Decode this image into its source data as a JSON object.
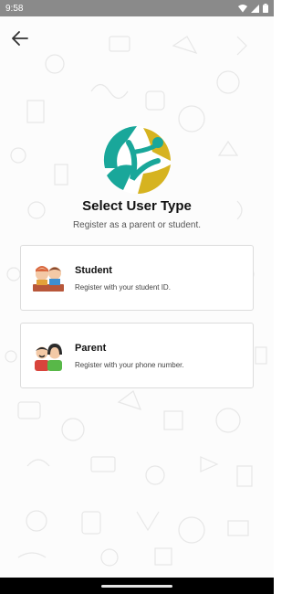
{
  "status_bar": {
    "time": "9:58"
  },
  "header": {
    "back_icon": "arrow-left-icon"
  },
  "logo": {
    "icon": "app-logo",
    "colors": {
      "teal": "#19a79a",
      "gold": "#d6b320"
    }
  },
  "title": "Select User Type",
  "subtitle": "Register as a parent or student.",
  "options": [
    {
      "label": "Student",
      "description": "Register with your student ID.",
      "icon": "students-avatar-icon"
    },
    {
      "label": "Parent",
      "description": "Register with your phone number.",
      "icon": "parents-avatar-icon"
    }
  ],
  "colors": {
    "status_bar": "#8a8a8a",
    "nav_bar": "#000000",
    "card_border": "#dcdcdc"
  }
}
